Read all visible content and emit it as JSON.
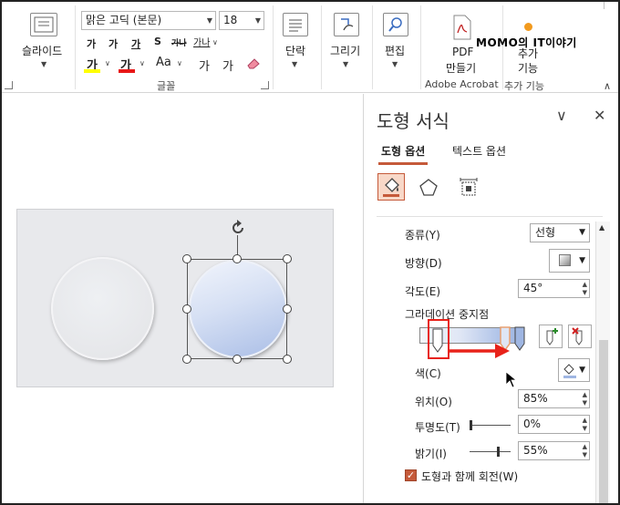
{
  "ribbon": {
    "slide_layout_label": "슬라이드",
    "font_name": "맑은 고딕 (본문)",
    "font_size": "18",
    "grow_font": "가",
    "shrink_font": "가",
    "underline": "가",
    "strikethrough": "S",
    "char_spacing": "가나",
    "change_case": "가나",
    "highlight": "가",
    "font_color": "가",
    "text_effects": "Aa",
    "increase_size": "가",
    "decrease_size": "가",
    "font_group_label": "글꼴",
    "paragraph_label": "단락",
    "draw_label": "그리기",
    "edit_label": "편집",
    "pdf_line1": "PDF",
    "pdf_line2": "만들기",
    "acrobat_group_label": "Adobe Acrobat",
    "addin_line1": "추가",
    "addin_line2": "기능",
    "addin_group_label": "추가 기능"
  },
  "watermark": "MOMO의 IT이야기",
  "panel": {
    "title": "도형 서식",
    "tabs": [
      "도형 옵션",
      "텍스트 옵션"
    ],
    "type_label": "종류(Y)",
    "type_value": "선형",
    "direction_label": "방향(D)",
    "angle_label": "각도(E)",
    "angle_value": "45°",
    "stops_label": "그라데이션 중지점",
    "color_label": "색(C)",
    "position_label": "위치(O)",
    "position_value": "85%",
    "transparency_label": "투명도(T)",
    "transparency_value": "0%",
    "brightness_label": "밝기(I)",
    "brightness_value": "55%",
    "rotate_label": "도형과 함께 회전(W)"
  },
  "state": {
    "transparency": 0,
    "brightness": 0.55,
    "rotate_with_shape": true
  },
  "colors": {
    "accent": "#c55a3a",
    "annotation_red": "#e8221a"
  }
}
